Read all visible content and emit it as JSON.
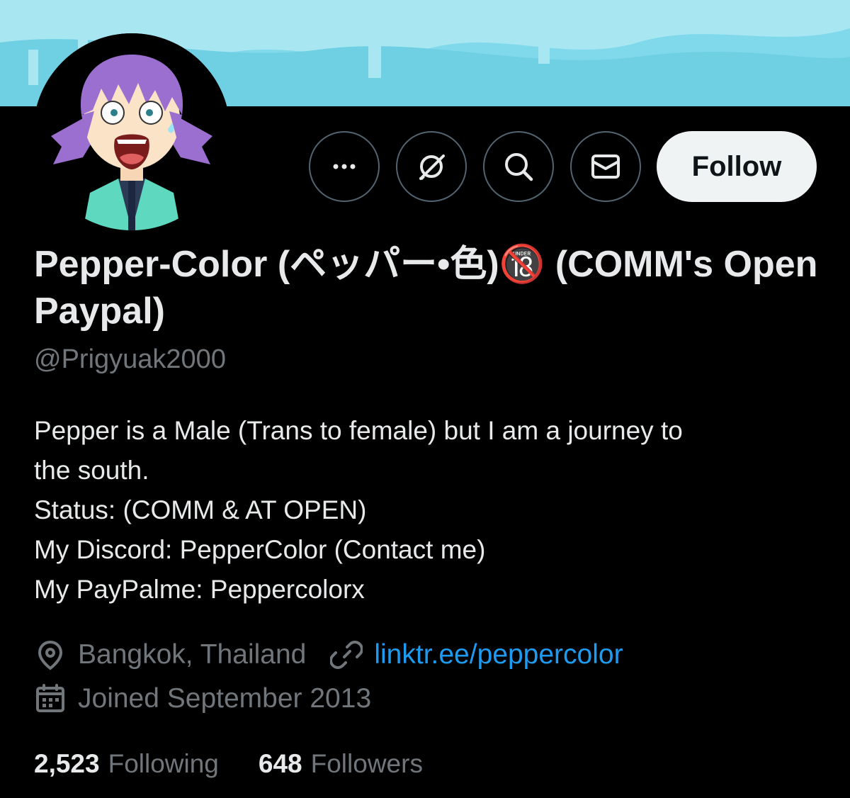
{
  "profile": {
    "display_name": "Pepper-Color (ペッパー•色)🔞 (COMM's Open Paypal)",
    "handle": "@Prigyuak2000",
    "bio": [
      "Pepper is a Male (Trans to female) but I am a journey to",
      "the south.",
      "Status: (COMM & AT OPEN)",
      "My Discord: PepperColor (Contact me)",
      "My PayPalme: Peppercolorx"
    ],
    "location": "Bangkok, Thailand",
    "website": "linktr.ee/peppercolor",
    "joined": "Joined September 2013"
  },
  "actions": {
    "follow_label": "Follow",
    "icons": [
      "more-icon",
      "grok-icon",
      "search-icon",
      "message-icon"
    ]
  },
  "stats": {
    "following_count": "2,523",
    "following_label": "Following",
    "followers_count": "648",
    "followers_label": "Followers"
  },
  "colors": {
    "background": "#000000",
    "banner": "#7fd9ea",
    "text_primary": "#e7e9ea",
    "text_secondary": "#71767b",
    "link": "#1d9bf0",
    "follow_button_bg": "#eff3f4"
  }
}
